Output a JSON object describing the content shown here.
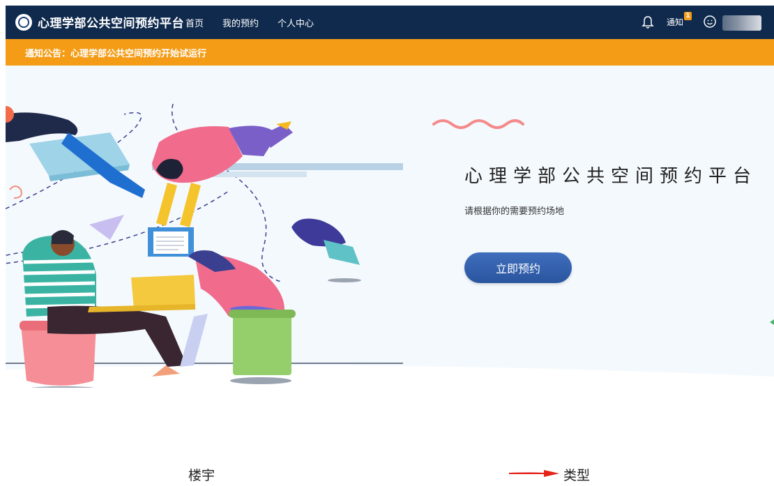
{
  "navbar": {
    "brand": "心理学部公共空间预约平台",
    "links": [
      "首页",
      "我的预约",
      "个人中心"
    ],
    "notification_label": "通知",
    "notification_count": "1",
    "icons": [
      "logo-emblem-icon",
      "bell-icon",
      "user-face-icon"
    ]
  },
  "announcement": {
    "text": "通知公告：心理学部公共空间预约开始试运行"
  },
  "hero": {
    "title": "心理学部公共空间预约平台",
    "subtitle": "请根据你的需要预约场地",
    "cta": "立即预约"
  },
  "sections": {
    "building": "楼宇",
    "type": "类型"
  },
  "colors": {
    "navbar_bg": "#0f2a4d",
    "announcement_bg": "#f49c16",
    "hero_bg": "#f4f9fd",
    "cta": "#2f5fae",
    "arrow": "#e5231b"
  }
}
